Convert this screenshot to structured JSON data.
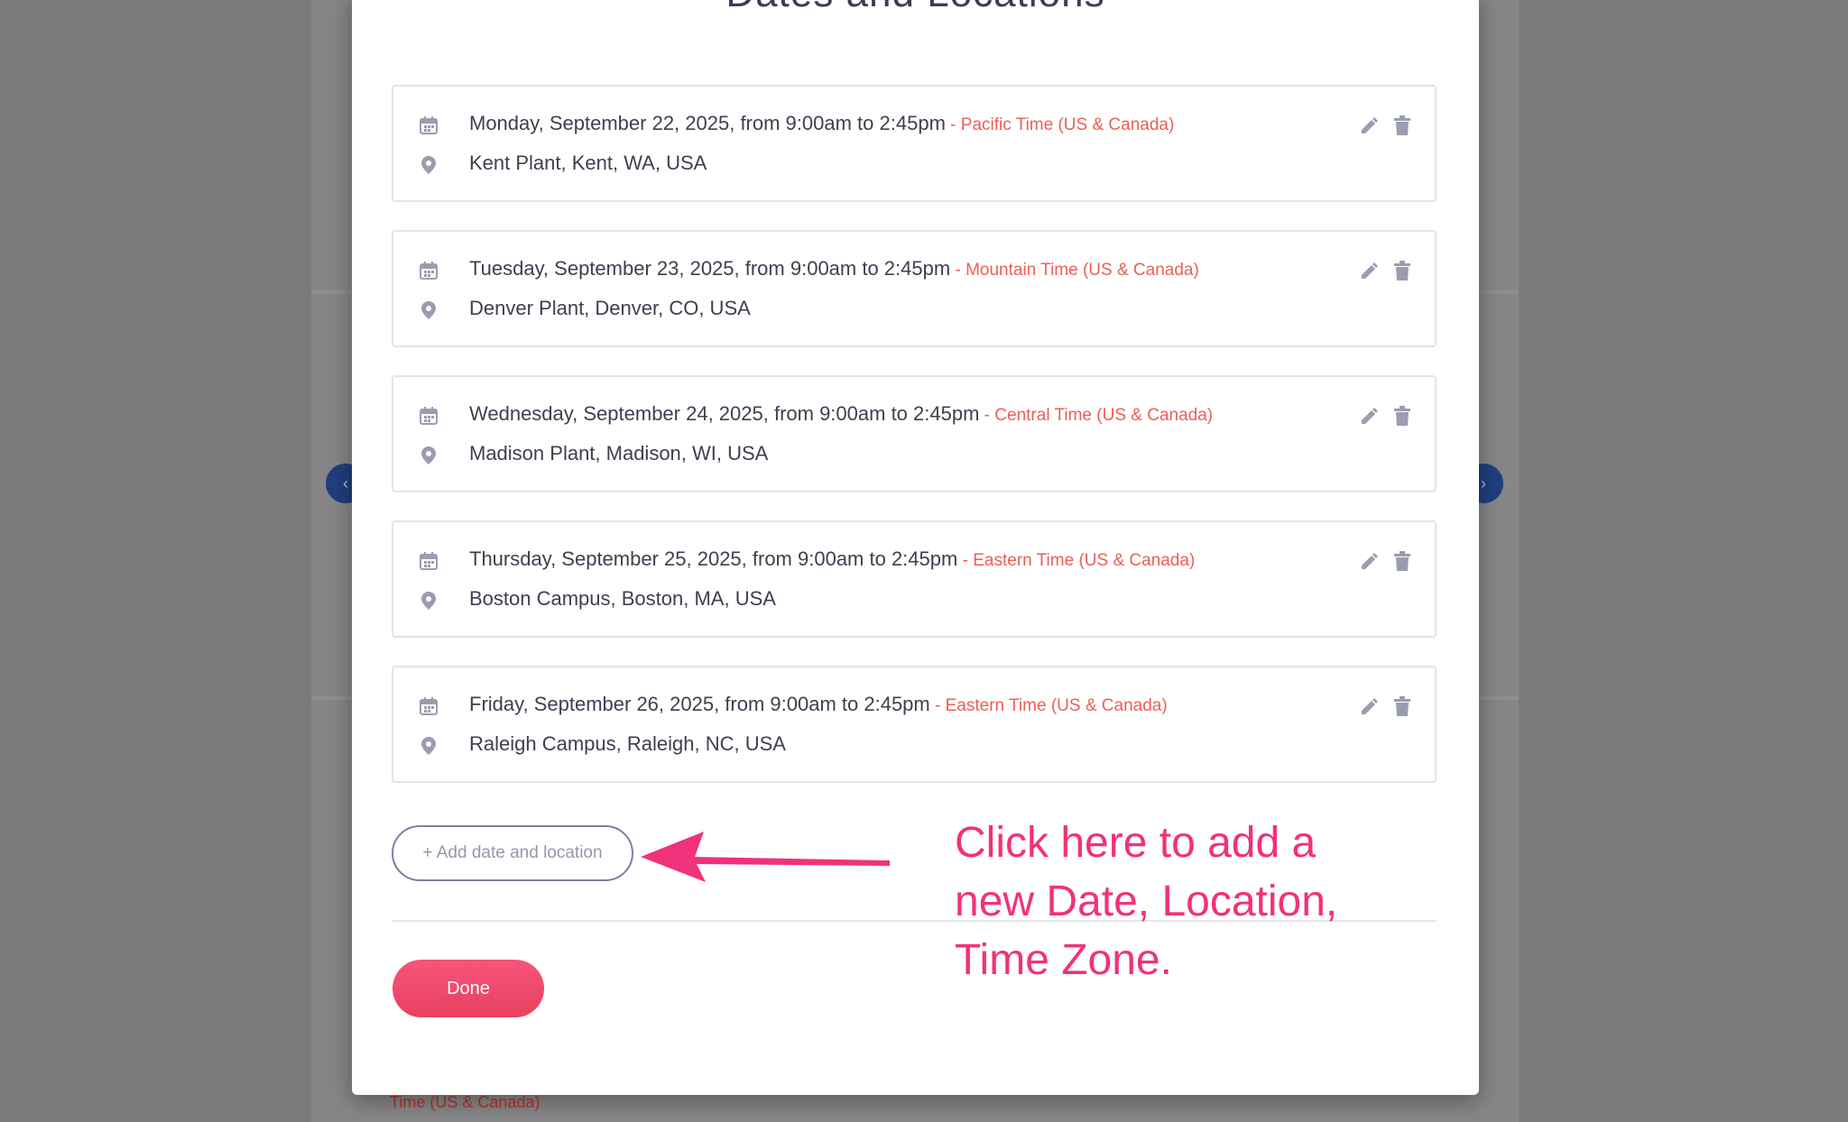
{
  "background": {
    "partial_timezone_text": "Time (US & Canada)",
    "prev_label": "‹",
    "next_label": "›"
  },
  "modal": {
    "title": "Dates and Locations",
    "entries": [
      {
        "date": "Monday, September 22, 2025, from 9:00am to 2:45pm",
        "timezone": " - Pacific Time (US & Canada)",
        "location": "Kent Plant, Kent, WA, USA"
      },
      {
        "date": "Tuesday, September 23, 2025, from 9:00am to 2:45pm",
        "timezone": " - Mountain Time (US & Canada)",
        "location": "Denver Plant, Denver, CO, USA"
      },
      {
        "date": "Wednesday, September 24, 2025, from 9:00am to 2:45pm",
        "timezone": " - Central Time (US & Canada)",
        "location": "Madison Plant, Madison, WI, USA"
      },
      {
        "date": "Thursday, September 25, 2025, from 9:00am to 2:45pm",
        "timezone": " - Eastern Time (US & Canada)",
        "location": "Boston Campus, Boston, MA, USA"
      },
      {
        "date": "Friday, September 26, 2025, from 9:00am to 2:45pm",
        "timezone": " - Eastern Time (US & Canada)",
        "location": "Raleigh Campus, Raleigh, NC, USA"
      }
    ],
    "add_button_label": "+ Add date and location",
    "done_button_label": "Done"
  },
  "annotation": {
    "line1": "Click here to add a",
    "line2": "new Date, Location,",
    "line3": "Time Zone."
  },
  "icons": {
    "date": "calendar-icon",
    "location": "map-pin-icon",
    "edit": "pencil-icon",
    "delete": "trash-icon"
  },
  "colors": {
    "timezone_text": "#ec5e55",
    "done_button": "#f04b6c",
    "annotation": "#f0327a",
    "icon_gray": "#9a9cb0"
  }
}
